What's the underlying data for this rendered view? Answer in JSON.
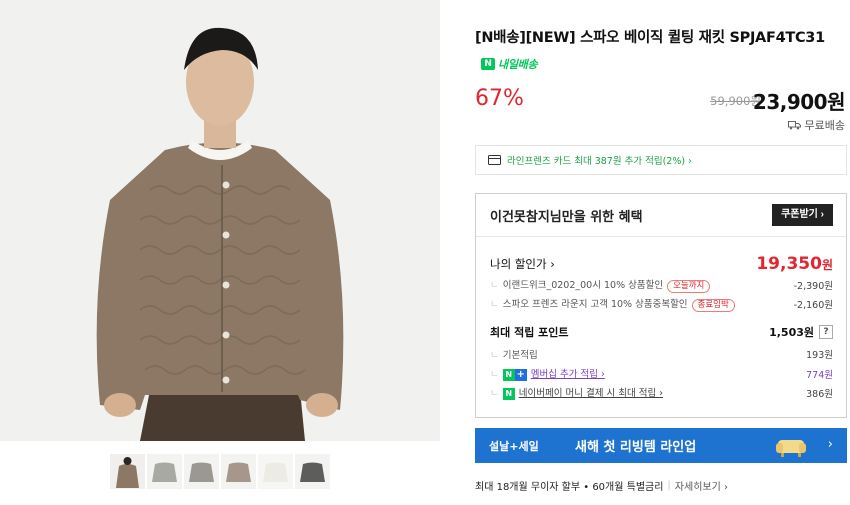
{
  "product": {
    "title": "[N배송][NEW] 스파오 베이직 퀼팅 재킷 SPJAF4TC31",
    "delivery_badge": "내일배송",
    "discount_rate": "67%",
    "original_price": "59,900원",
    "sale_price": "23,900원",
    "shipping": "무료배송"
  },
  "card_offer": "라인프렌즈 카드 최대 387원 추가 적립(2%) ›",
  "benefit": {
    "title": "이건못참지님만을 위한 혜택",
    "coupon_button": "쿠폰받기 ›",
    "my_discount_label": "나의 할인가 ›",
    "my_discount_price": "19,350",
    "my_discount_unit": "원",
    "coupons": [
      {
        "label": "이랜드위크_0202_00시 10% 상품할인",
        "tag": "오늘까지",
        "amount": "-2,390원"
      },
      {
        "label": "스파오 프렌즈 라운지 고객 10% 상품중복할인",
        "tag": "종료임박",
        "amount": "-2,160원"
      }
    ],
    "points_label": "최대 적립 포인트",
    "points_value": "1,503원",
    "points_help": "?",
    "point_rows": [
      {
        "label": "기본적립",
        "amount": "193원"
      },
      {
        "label": "멤버십 추가 적립 ›",
        "amount": "774원"
      },
      {
        "label": "네이버페이 머니 결제 시 최대 적립 ›",
        "amount": "386원"
      }
    ]
  },
  "banner": {
    "tag": "설날+세일",
    "text": "새해 첫 리빙템 라인업",
    "chevron": "›"
  },
  "installment": {
    "text": "최대 18개월 무이자 할부 • 60개월 특별금리",
    "more": "자세히보기 ›"
  },
  "colors": {
    "accent_red": "#e0262e",
    "naver_green": "#03c75a",
    "banner_blue": "#1e73d0"
  }
}
